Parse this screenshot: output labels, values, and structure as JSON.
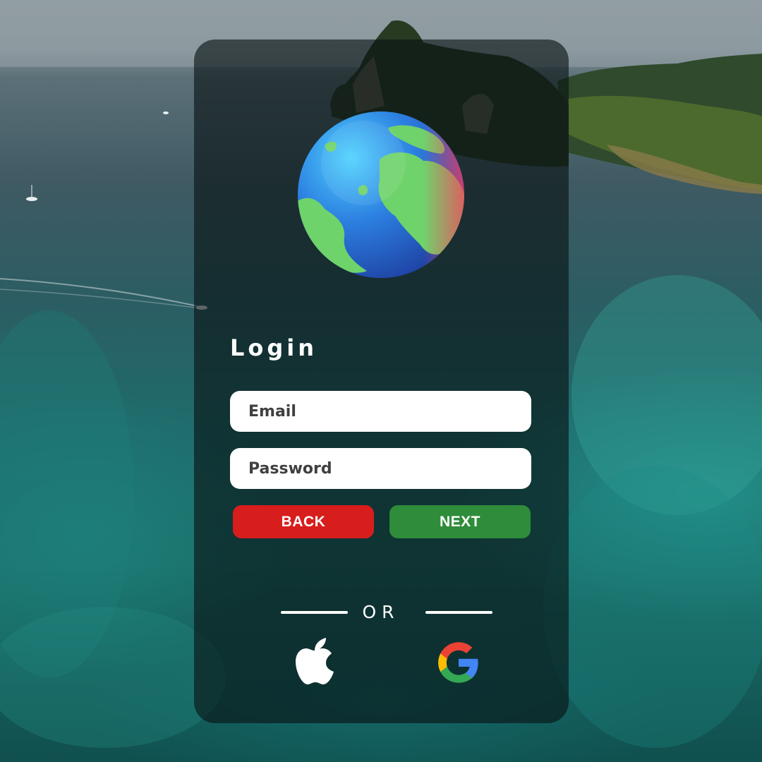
{
  "login": {
    "title": "Login",
    "email_placeholder": "Email",
    "password_placeholder": "Password",
    "back_label": "BACK",
    "next_label": "NEXT",
    "divider_text": "OR"
  },
  "social": [
    {
      "icon": "apple-icon"
    },
    {
      "icon": "google-icon"
    }
  ],
  "colors": {
    "back_button": "#d81d1d",
    "next_button": "#2f8c3a",
    "card_background": "rgba(8,18,20,0.62)",
    "input_background": "#ffffff"
  }
}
